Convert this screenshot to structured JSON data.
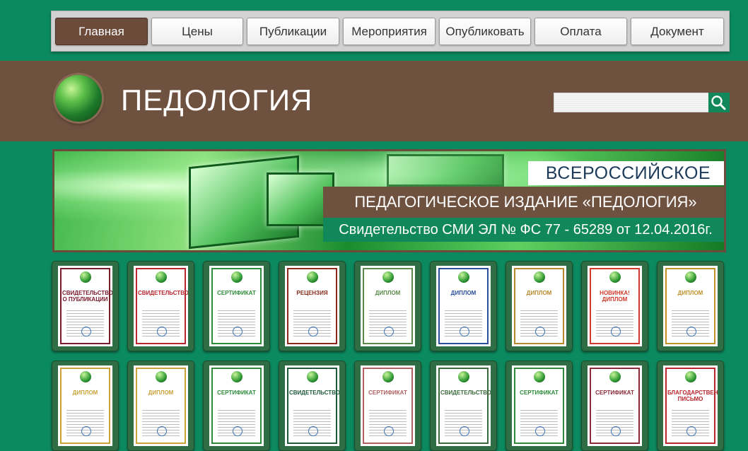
{
  "nav": {
    "items": [
      {
        "label": "Главная",
        "active": true
      },
      {
        "label": "Цены",
        "active": false
      },
      {
        "label": "Публикации",
        "active": false
      },
      {
        "label": "Мероприятия",
        "active": false
      },
      {
        "label": "Опубликовать",
        "active": false
      },
      {
        "label": "Оплата",
        "active": false
      },
      {
        "label": "Документ",
        "active": false
      }
    ]
  },
  "header": {
    "site_title": "ПЕДОЛОГИЯ",
    "logo_icon": "globe-icon",
    "search": {
      "value": "",
      "placeholder": "",
      "button_icon": "search-icon"
    }
  },
  "banner": {
    "line1": "ВСЕРОССИЙСКОЕ",
    "line2": "ПЕДАГОГИЧЕСКОЕ ИЗДАНИЕ «ПЕДОЛОГИЯ»",
    "line3": "Свидетельство СМИ ЭЛ № ФС 77 - 65289 от 12.04.2016г."
  },
  "documents": {
    "row1": [
      {
        "title": "СВИДЕТЕЛЬСТВО О ПУБЛИКАЦИИ",
        "accent": "#7a1b2d"
      },
      {
        "title": "СВИДЕТЕЛЬСТВО",
        "accent": "#b8252c"
      },
      {
        "title": "СЕРТИФИКАТ",
        "accent": "#2e8b3a"
      },
      {
        "title": "РЕЦЕНЗИЯ",
        "accent": "#8b2a1a"
      },
      {
        "title": "ДИПЛОМ",
        "accent": "#5a8a4a"
      },
      {
        "title": "ДИПЛОМ",
        "accent": "#2a4f9a"
      },
      {
        "title": "ДИПЛОМ",
        "accent": "#b8892a"
      },
      {
        "title": "НОВИНКА! ДИПЛОМ",
        "accent": "#d0392a"
      },
      {
        "title": "ДИПЛОМ",
        "accent": "#c0902a"
      }
    ],
    "row2": [
      {
        "title": "ДИПЛОМ",
        "accent": "#c9a23a"
      },
      {
        "title": "ДИПЛОМ",
        "accent": "#c9a23a"
      },
      {
        "title": "СЕРТИФИКАТ",
        "accent": "#2e8b3a"
      },
      {
        "title": "СВИДЕТЕЛЬСТВО",
        "accent": "#1f5a3a"
      },
      {
        "title": "СЕРТИФИКАТ",
        "accent": "#b06060"
      },
      {
        "title": "СВИДЕТЕЛЬСТВО",
        "accent": "#3a6a3a"
      },
      {
        "title": "СЕРТИФИКАТ",
        "accent": "#2e8b3a"
      },
      {
        "title": "СЕРТИФИКАТ",
        "accent": "#8b2a3a"
      },
      {
        "title": "БЛАГОДАРСТВЕННОЕ ПИСЬМО",
        "accent": "#b8252c"
      }
    ]
  },
  "colors": {
    "background": "#0c8a5f",
    "header": "#6f5140",
    "nav_active": "#6c4b3a"
  }
}
